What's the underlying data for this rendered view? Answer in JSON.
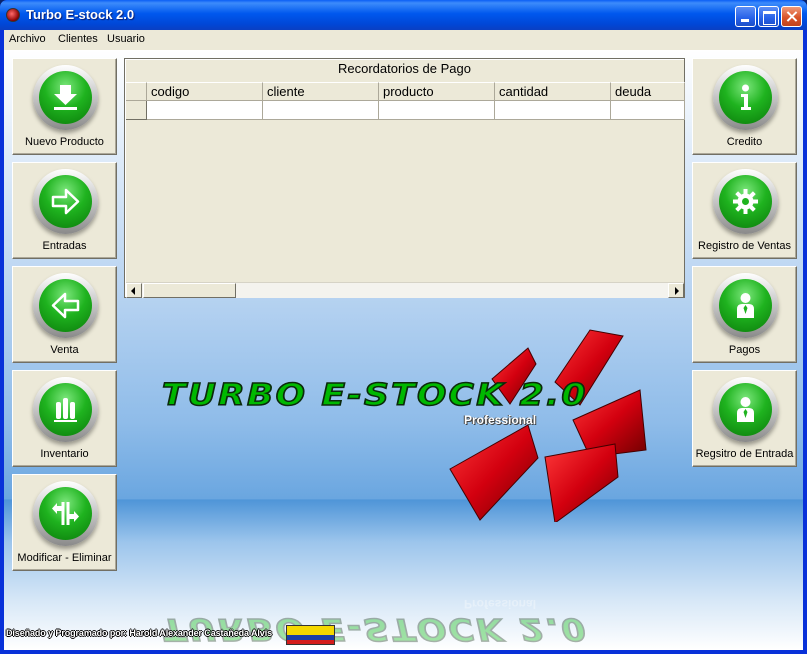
{
  "window": {
    "title": "Turbo E-stock 2.0"
  },
  "menu": [
    "Archivo",
    "Clientes",
    "Usuario"
  ],
  "left_buttons": [
    {
      "label": "Nuevo Producto",
      "icon": "download-icon"
    },
    {
      "label": "Entradas",
      "icon": "arrow-right-icon"
    },
    {
      "label": "Venta",
      "icon": "arrow-left-icon"
    },
    {
      "label": "Inventario",
      "icon": "bars-icon"
    },
    {
      "label": "Modificar - Eliminar",
      "icon": "split-arrows-icon"
    }
  ],
  "right_buttons": [
    {
      "label": "Credito",
      "icon": "info-icon"
    },
    {
      "label": "Registro de Ventas",
      "icon": "gear-icon"
    },
    {
      "label": "Pagos",
      "icon": "user-icon"
    },
    {
      "label": "Regsitro de Entrada",
      "icon": "user-icon"
    }
  ],
  "grid": {
    "caption": "Recordatorios de Pago",
    "columns": [
      "codigo",
      "cliente",
      "producto",
      "cantidad",
      "deuda"
    ]
  },
  "logo": {
    "title": "TURBO E-STOCK 2.0",
    "subtitle": "Professional"
  },
  "footer": {
    "credits": "Diseñado y Programado por: Harold Alexander Castañeda Alvis"
  },
  "colors": {
    "accent_green": "#1fb31f",
    "logo_red": "#d3000f",
    "titlebar_blue": "#0058ee"
  }
}
